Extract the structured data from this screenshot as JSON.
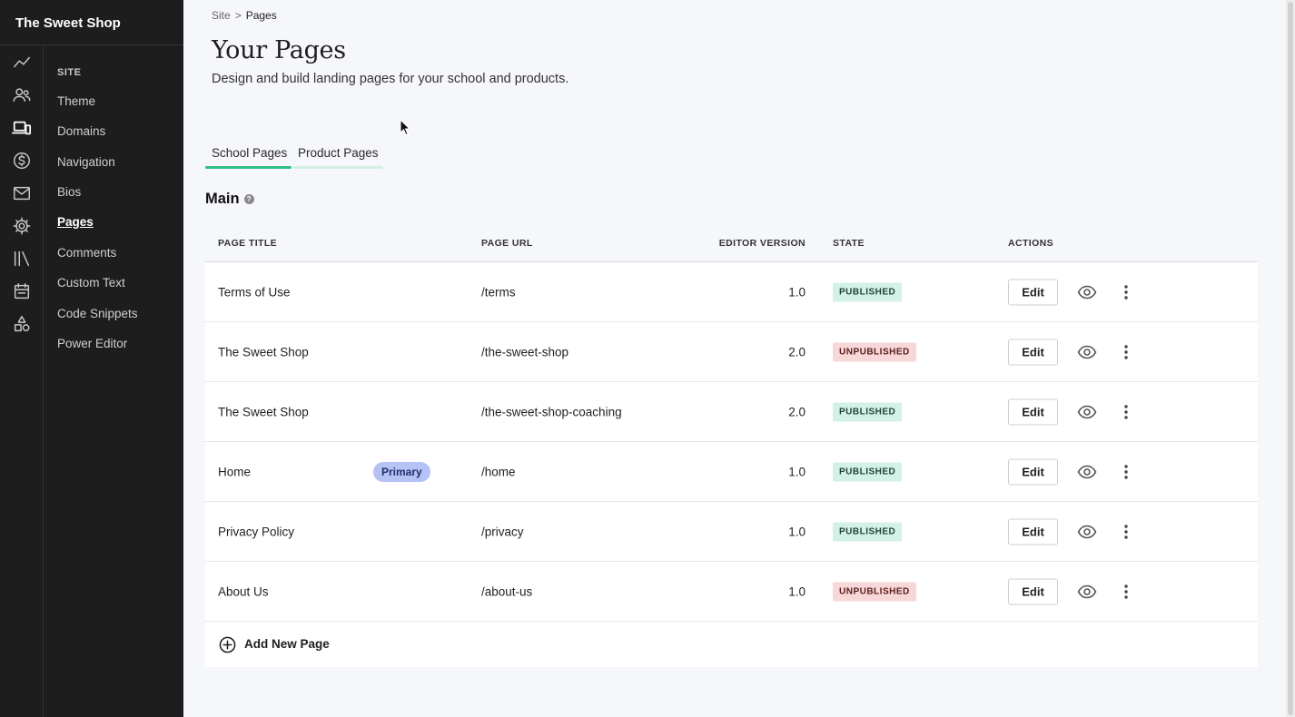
{
  "sidebar": {
    "brand": "The Sweet Shop",
    "rail_icons": [
      "analytics-icon",
      "users-icon",
      "site-devices-icon",
      "sales-dollar-icon",
      "email-icon",
      "settings-gear-icon",
      "library-icon",
      "calendar-icon",
      "shapes-icon"
    ],
    "active_rail_icon": "site-devices-icon",
    "subnav_heading": "SITE",
    "subnav_items": [
      "Theme",
      "Domains",
      "Navigation",
      "Bios",
      "Pages",
      "Comments",
      "Custom Text",
      "Code Snippets",
      "Power Editor"
    ],
    "active_subnav_item": "Pages"
  },
  "breadcrumb": {
    "root": "Site",
    "separator": ">",
    "current": "Pages"
  },
  "header": {
    "title": "Your Pages",
    "subtitle": "Design and build landing pages for your school and products."
  },
  "tabs": [
    {
      "label": "School Pages",
      "active": true
    },
    {
      "label": "Product Pages",
      "active": false
    }
  ],
  "section": {
    "title": "Main",
    "help_icon": "question-circle-icon"
  },
  "table": {
    "columns": [
      "PAGE TITLE",
      "PAGE URL",
      "EDITOR VERSION",
      "STATE",
      "ACTIONS"
    ],
    "rows": [
      {
        "title": "Terms of Use",
        "badge": "",
        "url": "/terms",
        "version": "1.0",
        "state": "PUBLISHED"
      },
      {
        "title": "The Sweet Shop",
        "badge": "",
        "url": "/the-sweet-shop",
        "version": "2.0",
        "state": "UNPUBLISHED"
      },
      {
        "title": "The Sweet Shop",
        "badge": "",
        "url": "/the-sweet-shop-coaching",
        "version": "2.0",
        "state": "PUBLISHED"
      },
      {
        "title": "Home",
        "badge": "Primary",
        "url": "/home",
        "version": "1.0",
        "state": "PUBLISHED"
      },
      {
        "title": "Privacy Policy",
        "badge": "",
        "url": "/privacy",
        "version": "1.0",
        "state": "PUBLISHED"
      },
      {
        "title": "About Us",
        "badge": "",
        "url": "/about-us",
        "version": "1.0",
        "state": "UNPUBLISHED"
      }
    ],
    "edit_label": "Edit",
    "add_label": "Add New Page"
  },
  "colors": {
    "sidebar_bg": "#1d1d1d",
    "accent_green": "#2fbf86",
    "published_bg": "#d3f1e6",
    "unpublished_bg": "#f7d7d7",
    "primary_badge_bg": "#b4c2f4"
  }
}
